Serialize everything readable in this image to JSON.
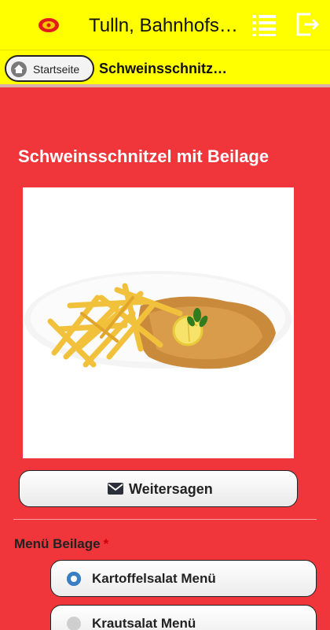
{
  "header": {
    "title": "Tulln, Bahnhofstraße"
  },
  "breadcrumb": {
    "home_label": "Startseite",
    "current": "Schweinsschnitzel mit Beilage"
  },
  "product": {
    "title": "Schweinsschnitzel mit Beilage"
  },
  "share": {
    "label": "Weitersagen"
  },
  "options": {
    "label": "Menü Beilage",
    "required_mark": "*",
    "items": [
      {
        "label": "Kartoffelsalat Menü",
        "selected": true
      },
      {
        "label": "Krautsalat Menü",
        "selected": false
      }
    ]
  },
  "colors": {
    "header_bg": "#ffff00",
    "page_bg": "#f0353b",
    "radio_selected": "#3a7fc3"
  },
  "icons": [
    "logo-icon",
    "menu-list-icon",
    "logout-icon",
    "home-icon",
    "mail-icon"
  ]
}
